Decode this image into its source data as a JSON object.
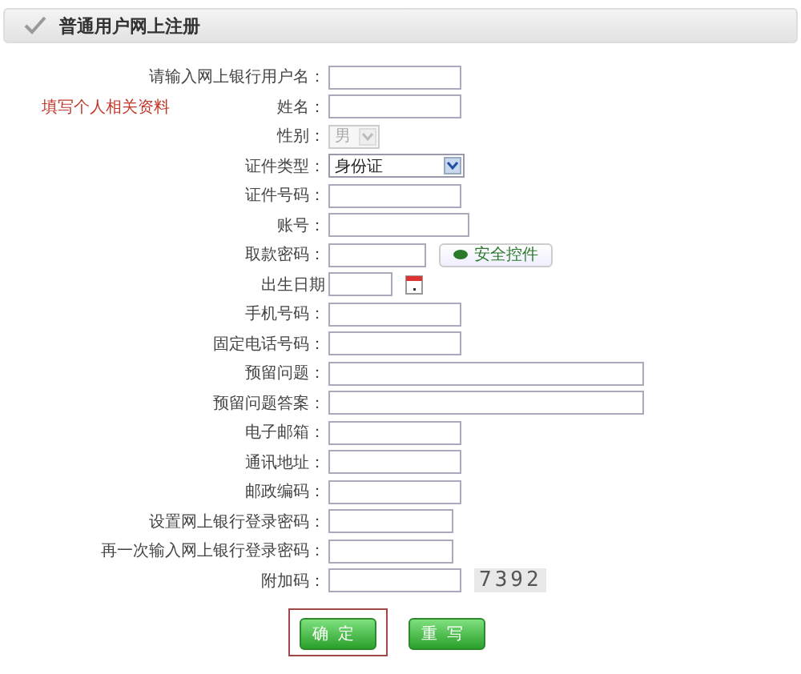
{
  "header": {
    "title": "普通用户网上注册"
  },
  "note": "填写个人相关资料",
  "fields": [
    {
      "label": "请输入网上银行用户名：",
      "kind": "text"
    },
    {
      "label": "姓名：",
      "kind": "text"
    },
    {
      "label": "性别：",
      "kind": "select",
      "value": "男",
      "disabled": true
    },
    {
      "label": "证件类型：",
      "kind": "select",
      "value": "身份证",
      "disabled": false
    },
    {
      "label": "证件号码：",
      "kind": "text"
    },
    {
      "label": "账号：",
      "kind": "text"
    },
    {
      "label": "取款密码：",
      "kind": "password_control",
      "button": "安全控件"
    },
    {
      "label": "出生日期",
      "kind": "date"
    },
    {
      "label": "手机号码：",
      "kind": "text"
    },
    {
      "label": "固定电话号码：",
      "kind": "text"
    },
    {
      "label": "预留问题：",
      "kind": "text"
    },
    {
      "label": "预留问题答案：",
      "kind": "text"
    },
    {
      "label": "电子邮箱：",
      "kind": "text"
    },
    {
      "label": "通讯地址：",
      "kind": "text"
    },
    {
      "label": "邮政编码：",
      "kind": "text"
    },
    {
      "label": "设置网上银行登录密码：",
      "kind": "text"
    },
    {
      "label": "再一次输入网上银行登录密码：",
      "kind": "text"
    },
    {
      "label": "附加码：",
      "kind": "captcha",
      "code": "7392"
    }
  ],
  "buttons": [
    {
      "label": "确定",
      "focused": true
    },
    {
      "label": "重写",
      "focused": false
    }
  ]
}
